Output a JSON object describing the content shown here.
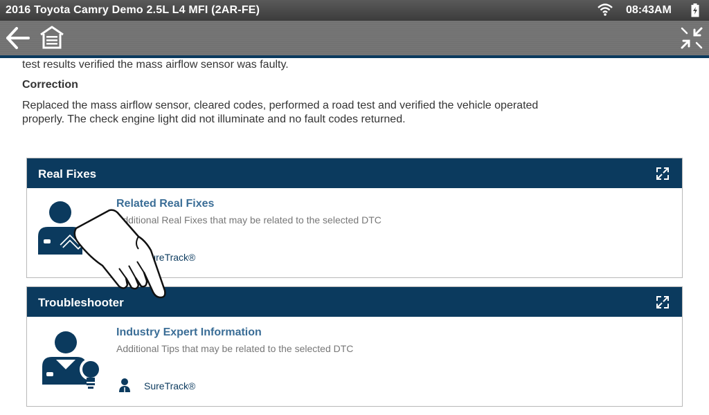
{
  "status_bar": {
    "title": "2016 Toyota Camry Demo 2.5L L4 MFI (2AR-FE)",
    "time": "08:43AM"
  },
  "toolbar": {
    "back_icon": "back-arrow-icon",
    "home_icon": "home-icon",
    "collapse_icon": "collapse-icon"
  },
  "content": {
    "intro_tail": "test results verified the mass airflow sensor was faulty.",
    "correction_heading": "Correction",
    "correction_line1": "Replaced the mass airflow sensor, cleared codes, performed a road test and verified the vehicle operated",
    "correction_line2": "properly. The check engine light did not illuminate and no fault codes returned."
  },
  "cards": [
    {
      "header": "Real Fixes",
      "title": "Related Real Fixes",
      "description": "Additional Real Fixes that may be related to the selected DTC",
      "source": "SureTrack®"
    },
    {
      "header": "Troubleshooter",
      "title": "Industry Expert Information",
      "description": "Additional Tips that may be related to the selected DTC",
      "source": "SureTrack®"
    }
  ],
  "colors": {
    "header_blue": "#0b3a5e",
    "link_blue": "#3a6d96"
  }
}
